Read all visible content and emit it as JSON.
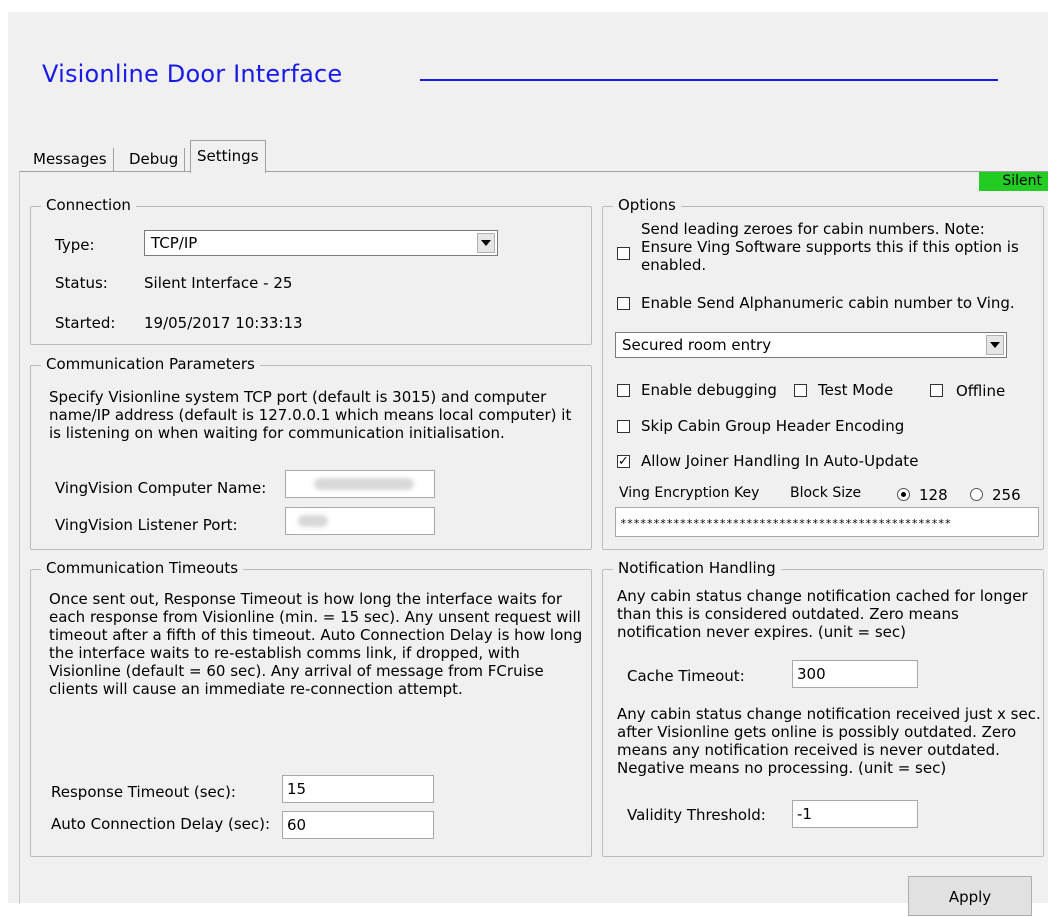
{
  "app": {
    "title": "Visionline Door Interface",
    "status_badge": "Silent"
  },
  "tabs": [
    {
      "label": "Messages"
    },
    {
      "label": "Debug"
    },
    {
      "label": "Settings"
    }
  ],
  "connection": {
    "title": "Connection",
    "type_label": "Type:",
    "type_value": "TCP/IP",
    "status_label": "Status:",
    "status_value": "Silent Interface - 25",
    "started_label": "Started:",
    "started_value": "19/05/2017 10:33:13"
  },
  "comm_params": {
    "title": "Communication Parameters",
    "description": "Specify Visionline system TCP port (default is 3015) and computer name/IP address (default is 127.0.0.1 which means local computer) it is listening on when waiting for communication initialisation.",
    "computer_name_label": "VingVision Computer Name:",
    "listener_port_label": "VingVision Listener Port:"
  },
  "comm_timeouts": {
    "title": "Communication Timeouts",
    "description": "Once sent out, Response Timeout is how long the interface waits for each response from Visionline (min. = 15 sec). Any unsent request will timeout after a fifth of this timeout. Auto Connection Delay is how long the interface waits to re-establish comms link, if dropped, with Visionline (default = 60 sec). Any arrival of message from FCruise clients will cause an immediate re-connection attempt.",
    "response_timeout_label": "Response Timeout (sec):",
    "response_timeout_value": "15",
    "auto_delay_label": "Auto Connection Delay (sec):",
    "auto_delay_value": "60"
  },
  "options": {
    "title": "Options",
    "leading_zeroes_label": "Send leading zeroes for cabin numbers. Note: Ensure Ving Software supports this if this option is enabled.",
    "leading_zeroes_checked": false,
    "alphanumeric_label": "Enable Send Alphanumeric cabin number to Ving.",
    "alphanumeric_checked": false,
    "entry_mode_value": "Secured room entry",
    "debugging_label": "Enable debugging",
    "debugging_checked": false,
    "test_mode_label": "Test Mode",
    "test_mode_checked": false,
    "offline_label": "Offline",
    "offline_checked": false,
    "skip_header_label": "Skip Cabin Group Header Encoding",
    "skip_header_checked": false,
    "joiner_label": "Allow Joiner Handling In Auto-Update",
    "joiner_checked": true,
    "encryption_key_label": "Ving Encryption Key",
    "block_size_label": "Block Size",
    "block_128_label": "128",
    "block_256_label": "256",
    "block_selected": "128",
    "encryption_key_value": "**************************************************"
  },
  "notification": {
    "title": "Notification Handling",
    "cache_description": "Any cabin status change notification cached for longer than this is considered outdated. Zero means notification never expires. (unit = sec)",
    "cache_timeout_label": "Cache Timeout:",
    "cache_timeout_value": "300",
    "validity_description": "Any cabin status change notification received just x sec. after Visionline gets online is possibly outdated. Zero means any notification received is never outdated. Negative means no processing. (unit = sec)",
    "validity_label": "Validity Threshold:",
    "validity_value": "-1"
  },
  "footer": {
    "apply_label": "Apply"
  },
  "colors": {
    "title_blue": "#1a1ae6",
    "silent_green": "#22cc22",
    "window_bg": "#f0f0f0"
  }
}
